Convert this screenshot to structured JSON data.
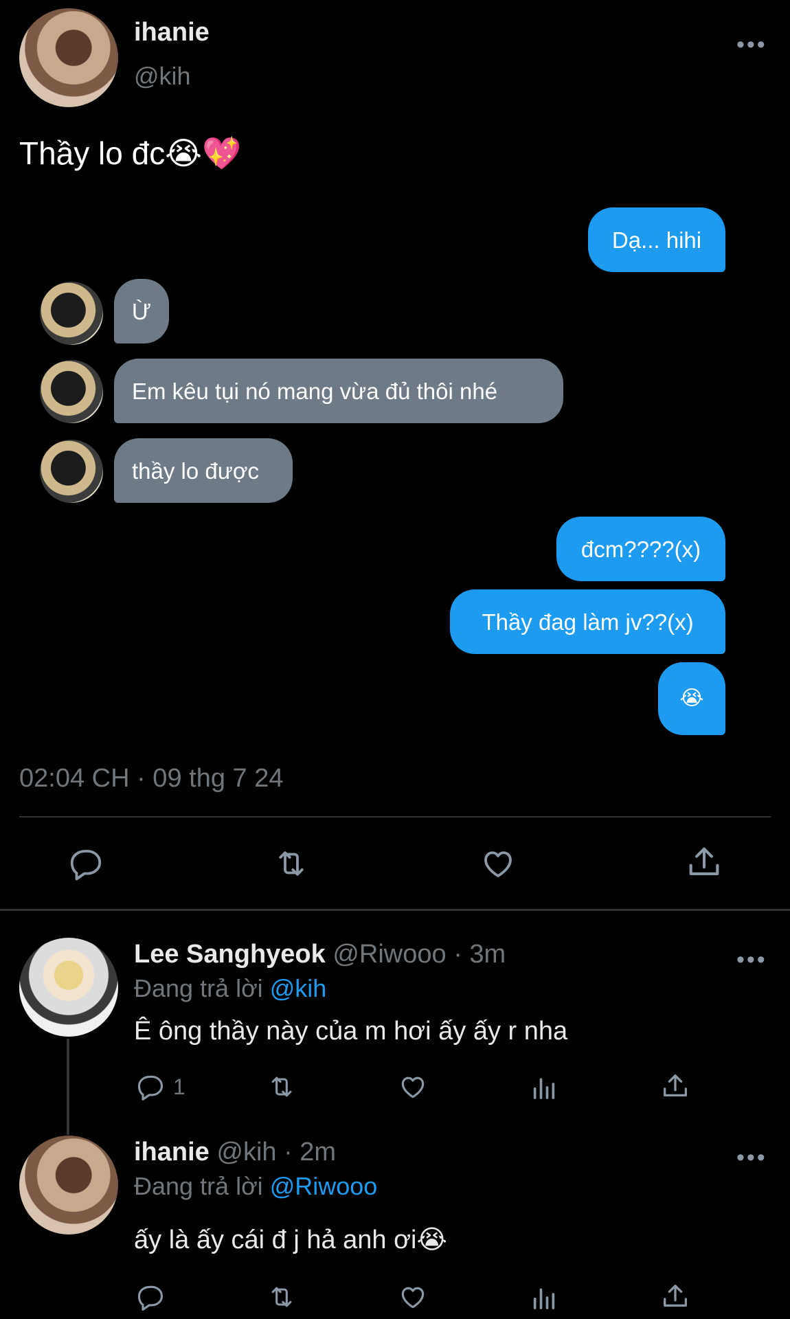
{
  "tweet": {
    "display_name": "ihanie",
    "handle": "@kih",
    "text": "Thầy lo đc😭💖",
    "timestamp": "02:04 CH · 09 thg 7 24",
    "messages": {
      "m1": "Dạ... hihi",
      "m2": "Ừ",
      "m3": "Em kêu tụi nó mang vừa đủ thôi nhé",
      "m4": "thầy lo được",
      "m5": "đcm????(x)",
      "m6": "Thầy đag làm jv??(x)",
      "m7": "😭"
    }
  },
  "replies": [
    {
      "display_name": "Lee Sanghyeok",
      "handle_time": "@Riwooo · 3m",
      "replying_prefix": "Đang trả lời",
      "replying_to": "@kih",
      "text": "Ê ông thầy này của m hơi ấy ấy r nha",
      "reply_count": "1"
    },
    {
      "display_name": "ihanie",
      "handle_time": "@kih · 2m",
      "replying_prefix": "Đang trả lời",
      "replying_to": "@Riwooo",
      "text": "ấy là ấy cái đ j hả anh ơi😭"
    }
  ],
  "icons": {
    "more": "more-horizontal-icon",
    "reply": "reply-icon",
    "retweet": "retweet-icon",
    "like": "heart-icon",
    "share": "share-icon",
    "views": "views-icon"
  },
  "colors": {
    "accent": "#1d9bf0",
    "bubble_other": "#6e7a86",
    "muted": "#71767b"
  }
}
